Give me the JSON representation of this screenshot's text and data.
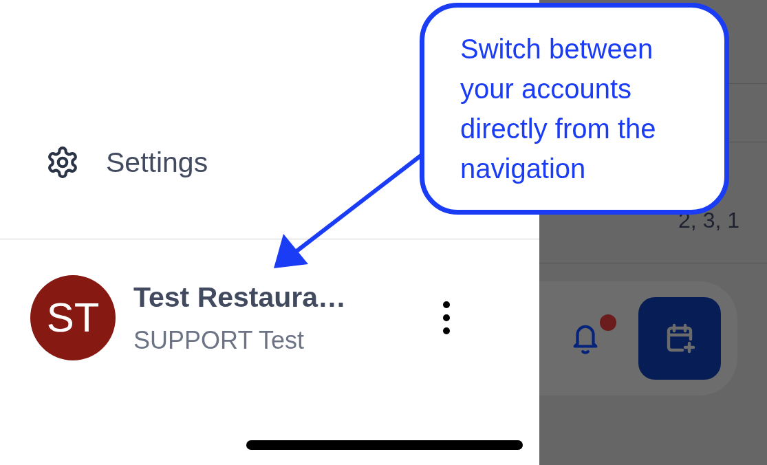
{
  "drawer": {
    "settings_item": {
      "label": "Settings"
    },
    "account": {
      "initials": "ST",
      "name": "Test Restaura…",
      "subtitle": "SUPPORT Test"
    }
  },
  "background": {
    "cell_text": "2, 3, 1",
    "notifications": {
      "unread": true
    },
    "schedule_button": {
      "kind": "calendar-add"
    }
  },
  "callout": {
    "text": "Switch between your accounts directly from the navigation"
  }
}
